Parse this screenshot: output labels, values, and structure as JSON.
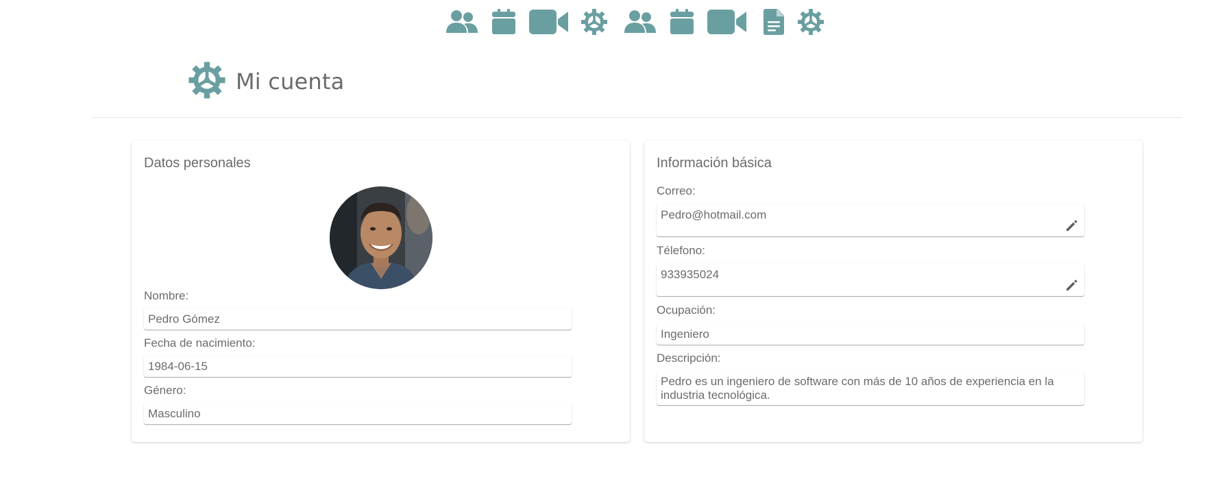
{
  "theme": {
    "accent": "#6a9fa1",
    "text": "#6b6b6b"
  },
  "topnav": {
    "icons": [
      "users-icon",
      "calendar-icon",
      "video-icon",
      "gear-icon",
      "users-icon",
      "calendar-icon",
      "video-icon",
      "document-icon",
      "gear-icon"
    ]
  },
  "header": {
    "icon": "gear-icon",
    "title": "Mi cuenta"
  },
  "personal": {
    "title": "Datos personales",
    "avatar_icon": "user-photo",
    "name_label": "Nombre:",
    "name_value": "Pedro Gómez",
    "birth_label": "Fecha de nacimiento:",
    "birth_value": "1984-06-15",
    "gender_label": "Género:",
    "gender_value": "Masculino"
  },
  "basic": {
    "title": "Información básica",
    "email_label": "Correo:",
    "email_value": "Pedro@hotmail.com",
    "phone_label": "Télefono:",
    "phone_value": "933935024",
    "occupation_label": "Ocupación:",
    "occupation_value": "Ingeniero",
    "description_label": "Descripción:",
    "description_value": "Pedro es un ingeniero de software con más de 10 años de experiencia en la industria tecnológica.",
    "edit_icon": "pencil-icon"
  }
}
